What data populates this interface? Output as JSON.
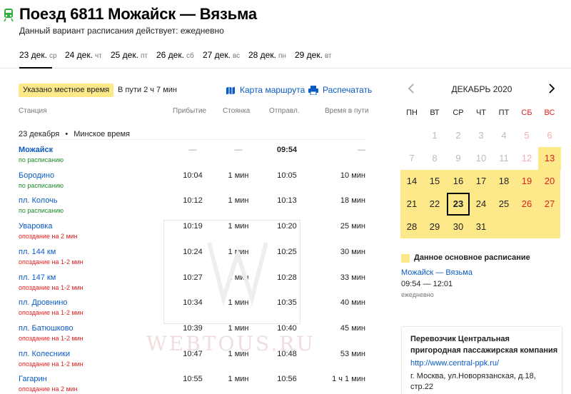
{
  "header": {
    "title": "Поезд 6811 Можайск — Вязьма",
    "subtitle": "Данный вариант расписания действует: ежедневно",
    "dates": [
      {
        "day": "23 дек.",
        "dow": "ср",
        "active": true
      },
      {
        "day": "24 дек.",
        "dow": "чт",
        "active": false
      },
      {
        "day": "25 дек.",
        "dow": "пт",
        "active": false
      },
      {
        "day": "26 дек.",
        "dow": "сб",
        "active": false
      },
      {
        "day": "27 дек.",
        "dow": "вс",
        "active": false
      },
      {
        "day": "28 дек.",
        "dow": "пн",
        "active": false
      },
      {
        "day": "29 дек.",
        "dow": "вт",
        "active": false
      }
    ]
  },
  "info": {
    "badge": "Указано местное время",
    "travel": "В пути 2 ч 7 мин",
    "map_link": "Карта маршрута",
    "print_link": "Распечатать"
  },
  "columns": {
    "station": "Станция",
    "arrival": "Прибытие",
    "stop": "Стоянка",
    "departure": "Отправл.",
    "travel_time": "Время в пути"
  },
  "day_header": {
    "date": "23 декабря",
    "sep": "•",
    "zone": "Минское время"
  },
  "stations": [
    {
      "name": "Можайск",
      "status": "по расписанию",
      "status_type": "ok",
      "arrival": "—",
      "stop": "—",
      "departure": "09:54",
      "travel": "—"
    },
    {
      "name": "Бородино",
      "status": "по расписанию",
      "status_type": "ok",
      "arrival": "10:04",
      "stop": "1 мин",
      "departure": "10:05",
      "travel": "10 мин"
    },
    {
      "name": "пл. Колочь",
      "status": "по расписанию",
      "status_type": "ok",
      "arrival": "10:12",
      "stop": "1 мин",
      "departure": "10:13",
      "travel": "18 мин"
    },
    {
      "name": "Уваровка",
      "status": "опоздание на 2 мин",
      "status_type": "late",
      "arrival": "10:19",
      "stop": "1 мин",
      "departure": "10:20",
      "travel": "25 мин"
    },
    {
      "name": "пл. 144 км",
      "status": "опоздание на 1-2 мин",
      "status_type": "late",
      "arrival": "10:24",
      "stop": "1 мин",
      "departure": "10:25",
      "travel": "30 мин"
    },
    {
      "name": "пл. 147 км",
      "status": "опоздание на 1-2 мин",
      "status_type": "late",
      "arrival": "10:27",
      "stop": "1 мин",
      "departure": "10:28",
      "travel": "33 мин"
    },
    {
      "name": "пл. Дровнино",
      "status": "опоздание на 1-2 мин",
      "status_type": "late",
      "arrival": "10:34",
      "stop": "1 мин",
      "departure": "10:35",
      "travel": "40 мин"
    },
    {
      "name": "пл. Батюшково",
      "status": "опоздание на 1-2 мин",
      "status_type": "late",
      "arrival": "10:39",
      "stop": "1 мин",
      "departure": "10:40",
      "travel": "45 мин"
    },
    {
      "name": "пл. Колесники",
      "status": "опоздание на 1-2 мин",
      "status_type": "late",
      "arrival": "10:47",
      "stop": "1 мин",
      "departure": "10:48",
      "travel": "53 мин"
    },
    {
      "name": "Гагарин",
      "status": "опоздание на 2 мин",
      "status_type": "late",
      "arrival": "10:55",
      "stop": "1 мин",
      "departure": "10:56",
      "travel": "1 ч 1 мин"
    }
  ],
  "watermark": {
    "logo_letter": "W",
    "text": "WEBTOUS.RU"
  },
  "calendar": {
    "month": "ДЕКАБРЬ 2020",
    "dows": [
      "ПН",
      "ВТ",
      "СР",
      "ЧТ",
      "ПТ",
      "СБ",
      "ВС"
    ],
    "weeks": [
      [
        "",
        "1",
        "2",
        "3",
        "4",
        "5",
        "6"
      ],
      [
        "7",
        "8",
        "9",
        "10",
        "11",
        "12",
        "13"
      ],
      [
        "14",
        "15",
        "16",
        "17",
        "18",
        "19",
        "20"
      ],
      [
        "21",
        "22",
        "23",
        "24",
        "25",
        "26",
        "27"
      ],
      [
        "28",
        "29",
        "30",
        "31",
        "",
        "",
        ""
      ]
    ],
    "first_active_day": 13,
    "selected_day": 23,
    "highlight_color": "#fde98a"
  },
  "legend": {
    "label": "Данное основное расписание",
    "route": "Можайск — Вязьма",
    "times": "09:54 — 12:01",
    "frequency": "ежедневно"
  },
  "carrier": {
    "name": "Перевозчик Центральная пригородная пассажирская компания",
    "url": "http://www.central-ppk.ru/",
    "address": "г. Москва, ул.Новорязанская, д.18, стр.22"
  },
  "colors": {
    "link": "#0a5bc4",
    "late": "#e02020",
    "ok": "#1c8a2b",
    "weekend": "#e02020"
  }
}
